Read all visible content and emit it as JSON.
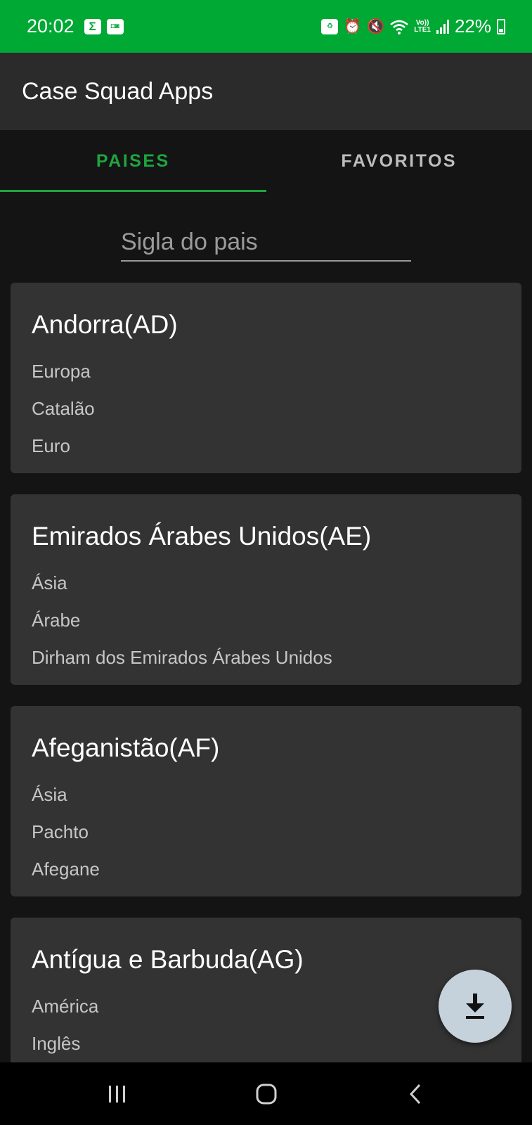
{
  "status_bar": {
    "time": "20:02",
    "left_icons": [
      "sigma-icon",
      "game-icon"
    ],
    "right_icons": [
      "battery-saver-icon",
      "alarm-icon",
      "mute-icon",
      "wifi-icon",
      "volte-icon",
      "signal-icon",
      "battery-icon"
    ],
    "volte_label_top": "Vo))",
    "volte_label_bottom": "LTE1",
    "battery_percent": "22%",
    "color": "#00a834"
  },
  "app_bar": {
    "title": "Case Squad Apps"
  },
  "tabs": [
    {
      "label": "PAISES",
      "active": true
    },
    {
      "label": "FAVORITOS",
      "active": false
    }
  ],
  "accent_color": "#1fa43f",
  "search": {
    "placeholder": "Sigla do pais",
    "value": ""
  },
  "countries": [
    {
      "name": "Andorra(AD)",
      "continent": "Europa",
      "language": "Catalão",
      "currency": "Euro"
    },
    {
      "name": "Emirados Árabes Unidos(AE)",
      "continent": "Ásia",
      "language": "Árabe",
      "currency": "Dirham dos Emirados Árabes Unidos"
    },
    {
      "name": "Afeganistão(AF)",
      "continent": "Ásia",
      "language": "Pachto",
      "currency": "Afegane"
    },
    {
      "name": "Antígua e Barbuda(AG)",
      "continent": "América",
      "language": "Inglês",
      "currency": ""
    }
  ],
  "fab": {
    "icon": "download-icon"
  },
  "nav_bar": {
    "buttons": [
      "recent-apps-icon",
      "home-icon",
      "back-icon"
    ]
  }
}
